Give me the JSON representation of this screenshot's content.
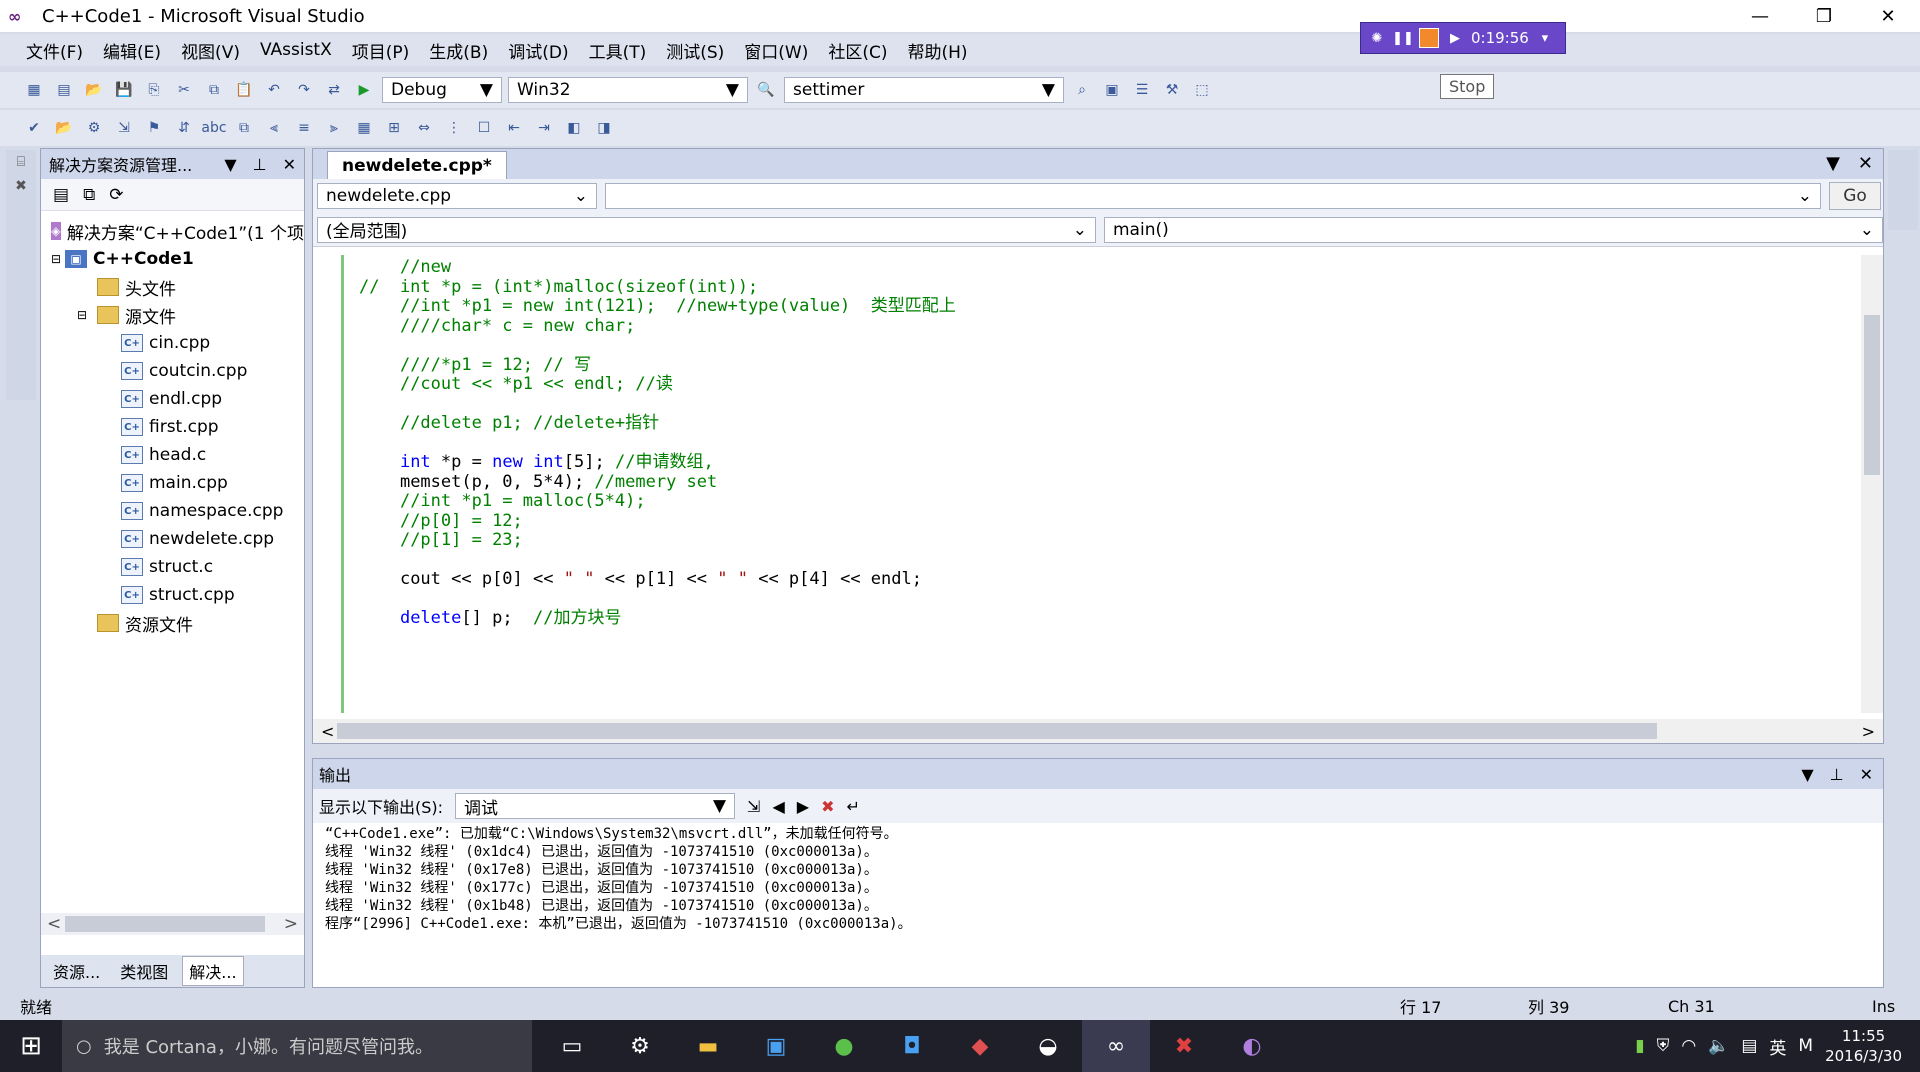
{
  "window": {
    "title": "C++Code1 - Microsoft Visual Studio",
    "min": "—",
    "max": "❐",
    "close": "✕"
  },
  "menu": [
    "文件(F)",
    "编辑(E)",
    "视图(V)",
    "VAssistX",
    "项目(P)",
    "生成(B)",
    "调试(D)",
    "工具(T)",
    "测试(S)",
    "窗口(W)",
    "社区(C)",
    "帮助(H)"
  ],
  "debugbar": {
    "time": "0:19:56",
    "tooltip": "Stop"
  },
  "toolbar": {
    "config": "Debug",
    "platform": "Win32",
    "find": "settimer"
  },
  "solution": {
    "header": "解决方案资源管理...",
    "root": "解决方案“C++Code1”(1 个项",
    "project": "C++Code1",
    "folder_headers": "头文件",
    "folder_sources": "源文件",
    "files": [
      "cin.cpp",
      "coutcin.cpp",
      "endl.cpp",
      "first.cpp",
      "head.c",
      "main.cpp",
      "namespace.cpp",
      "newdelete.cpp",
      "struct.c",
      "struct.cpp"
    ],
    "folder_resources": "资源文件",
    "tabs": [
      "资源...",
      "类视图",
      "解决..."
    ]
  },
  "editor": {
    "tab": "newdelete.cpp*",
    "file_combo": "newdelete.cpp",
    "scope": "(全局范围)",
    "function": "main()",
    "go": "Go"
  },
  "code_lines": [
    {
      "t": "//new",
      "c": "cm",
      "indent": "    "
    },
    {
      "t": "//  int *p = (int*)malloc(sizeof(int));",
      "c": "cm",
      "indent": ""
    },
    {
      "t": "//int *p1 = new int(121);  //new+type(value)  类型匹配上",
      "c": "cm",
      "indent": "    "
    },
    {
      "t": "////char* c = new char;",
      "c": "cm",
      "indent": "    "
    },
    {
      "t": "",
      "c": "",
      "indent": ""
    },
    {
      "t": "////*p1 = 12; // 写",
      "c": "cm",
      "indent": "    "
    },
    {
      "t": "//cout << *p1 << endl; //读",
      "c": "cm",
      "indent": "    "
    },
    {
      "t": "",
      "c": "",
      "indent": ""
    },
    {
      "t": "//delete p1; //delete+指针",
      "c": "cm",
      "indent": "    "
    },
    {
      "t": "",
      "c": "",
      "indent": ""
    },
    {
      "t": "int *p = new int[5]; //申请数组,",
      "c": "mix1",
      "indent": "    "
    },
    {
      "t": "memset(p, 0, 5*4); //memery set",
      "c": "mix2",
      "indent": "    "
    },
    {
      "t": "//int *p1 = malloc(5*4);",
      "c": "cm",
      "indent": "    "
    },
    {
      "t": "//p[0] = 12;",
      "c": "cm",
      "indent": "    "
    },
    {
      "t": "//p[1] = 23;",
      "c": "cm",
      "indent": "    "
    },
    {
      "t": "",
      "c": "",
      "indent": ""
    },
    {
      "t": "cout << p[0] << \" \" << p[1] << \" \" << p[4] << endl;",
      "c": "plain",
      "indent": "    "
    },
    {
      "t": "",
      "c": "",
      "indent": ""
    },
    {
      "t": "delete[] p;  //加方块号",
      "c": "mix3",
      "indent": "    "
    }
  ],
  "output": {
    "header": "输出",
    "show_label": "显示以下输出(S):",
    "source": "调试",
    "lines": [
      "“C++Code1.exe”: 已加载“C:\\Windows\\System32\\msvcrt.dll”，未加载任何符号。",
      "线程 'Win32 线程' (0x1dc4) 已退出，返回值为 -1073741510 (0xc000013a)。",
      "线程 'Win32 线程' (0x17e8) 已退出，返回值为 -1073741510 (0xc000013a)。",
      "线程 'Win32 线程' (0x177c) 已退出，返回值为 -1073741510 (0xc000013a)。",
      "线程 'Win32 线程' (0x1b48) 已退出，返回值为 -1073741510 (0xc000013a)。",
      "程序“[2996] C++Code1.exe: 本机”已退出，返回值为 -1073741510 (0xc000013a)。"
    ]
  },
  "status": {
    "ready": "就绪",
    "line": "行 17",
    "col": "列 39",
    "ch": "Ch 31",
    "ins": "Ins"
  },
  "taskbar": {
    "search": "我是 Cortana，小娜。有问题尽管问我。",
    "time": "11:55",
    "date": "2016/3/30",
    "lang": "英"
  }
}
